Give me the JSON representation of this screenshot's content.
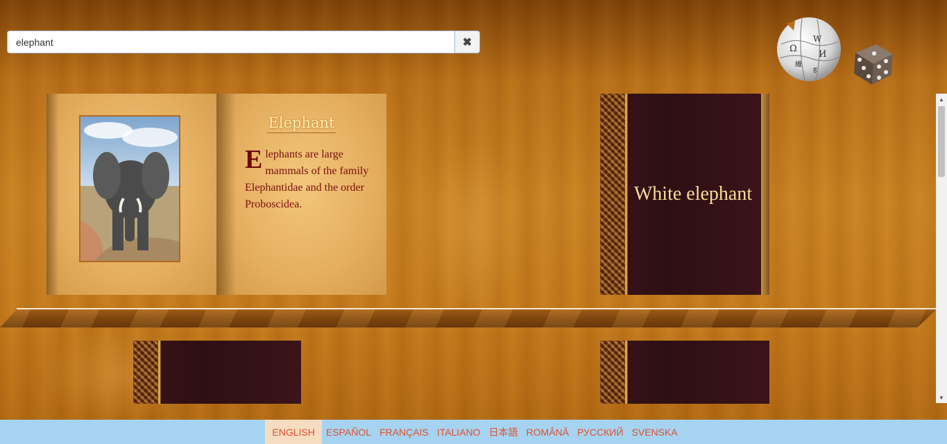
{
  "search": {
    "value": "elephant",
    "clear_label": "✖"
  },
  "books": {
    "featured": {
      "title": "Elephant",
      "dropcap": "E",
      "text": "lephants are large mammals of the family Elephantidae and the order Proboscidea."
    },
    "shelf_top_right": {
      "title": "White elephant"
    },
    "shelf_bottom": [
      {
        "title": ""
      },
      {
        "title": ""
      }
    ]
  },
  "scrollbar": {
    "up": "▲",
    "down": "▼"
  },
  "languages": {
    "active": "English",
    "items": [
      "English",
      "Español",
      "Français",
      "Italiano",
      "日本語",
      "Română",
      "Русский",
      "Svenska"
    ]
  },
  "icons": {
    "logo": "wikipedia-globe-icon",
    "random": "dice-icon",
    "clear": "close-icon"
  },
  "colors": {
    "accent": "#e05030",
    "lang_bar": "#a6d3ef",
    "book_cover": "#2e0f14"
  }
}
